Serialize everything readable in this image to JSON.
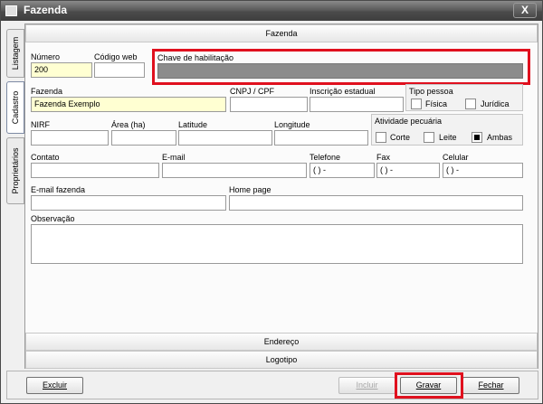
{
  "window": {
    "title": "Fazenda",
    "close_glyph": "X"
  },
  "side_tabs": [
    "Listagem",
    "Cadastro",
    "Proprietários"
  ],
  "sections": {
    "top": "Fazenda",
    "endereco": "Endereço",
    "logotipo": "Logotipo"
  },
  "form": {
    "numero": {
      "label": "Número",
      "value": "200"
    },
    "codigo_web": {
      "label": "Código web",
      "value": ""
    },
    "chave": {
      "label": "Chave de habilitação",
      "value": ""
    },
    "fazenda": {
      "label": "Fazenda",
      "value": "Fazenda Exemplo"
    },
    "cnpj": {
      "label": "CNPJ / CPF",
      "value": ""
    },
    "inscricao": {
      "label": "Inscrição estadual",
      "value": ""
    },
    "tipo_pessoa": {
      "label": "Tipo pessoa",
      "fisica": "Física",
      "juridica": "Jurídica"
    },
    "nirf": {
      "label": "NIRF",
      "value": ""
    },
    "area": {
      "label": "Área (ha)",
      "value": ""
    },
    "latitude": {
      "label": "Latitude",
      "value": ""
    },
    "longitude": {
      "label": "Longitude",
      "value": ""
    },
    "atividade": {
      "label": "Atividade pecuária",
      "corte": "Corte",
      "leite": "Leite",
      "ambas": "Ambas"
    },
    "contato": {
      "label": "Contato",
      "value": ""
    },
    "email": {
      "label": "E-mail",
      "value": ""
    },
    "telefone": {
      "label": "Telefone",
      "value": "( )  -"
    },
    "fax": {
      "label": "Fax",
      "value": "( )  -"
    },
    "celular": {
      "label": "Celular",
      "value": "( )  -"
    },
    "email_fazenda": {
      "label": "E-mail fazenda",
      "value": ""
    },
    "home_page": {
      "label": "Home page",
      "value": ""
    },
    "observacao": {
      "label": "Observação",
      "value": ""
    }
  },
  "buttons": {
    "excluir": "Excluir",
    "incluir": "Incluir",
    "gravar": "Gravar",
    "fechar": "Fechar"
  },
  "colors": {
    "highlight": "#e0101e",
    "required_field": "#ffffd2",
    "disabled_field": "#8c8c8c"
  }
}
